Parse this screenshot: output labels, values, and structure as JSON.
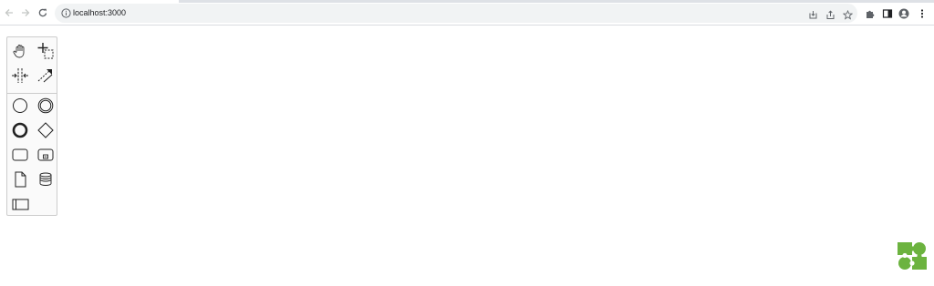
{
  "browser": {
    "url": "localhost:3000",
    "nav_icons": [
      "back-icon",
      "forward-icon",
      "reload-icon"
    ],
    "omnibox_icons": [
      "install-app-icon",
      "share-icon",
      "bookmark-star-icon"
    ],
    "toolbar_icons": [
      "extensions-icon",
      "side-panel-icon",
      "profile-icon",
      "menu-icon"
    ]
  },
  "palette": {
    "tools": [
      {
        "name": "hand-tool",
        "icon": "hand-icon"
      },
      {
        "name": "lasso-tool",
        "icon": "lasso-icon"
      },
      {
        "name": "space-tool",
        "icon": "space-icon"
      },
      {
        "name": "global-connect-tool",
        "icon": "connect-icon"
      },
      {
        "name": "create-start-event",
        "icon": "start-event-icon"
      },
      {
        "name": "create-intermediate-event",
        "icon": "intermediate-event-icon"
      },
      {
        "name": "create-end-event",
        "icon": "end-event-icon"
      },
      {
        "name": "create-gateway",
        "icon": "gateway-icon"
      },
      {
        "name": "create-task",
        "icon": "task-icon"
      },
      {
        "name": "create-subprocess",
        "icon": "subprocess-icon"
      },
      {
        "name": "create-data-object",
        "icon": "data-object-icon"
      },
      {
        "name": "create-data-store",
        "icon": "data-store-icon"
      },
      {
        "name": "create-pool",
        "icon": "pool-icon"
      }
    ]
  },
  "colors": {
    "logo_green": "#6cb33f",
    "omnibox_bg": "#f1f3f4",
    "icon_gray": "#5f6368",
    "palette_border": "#cccccc"
  },
  "logo": {
    "icon": "bpmn-io-logo-icon"
  }
}
